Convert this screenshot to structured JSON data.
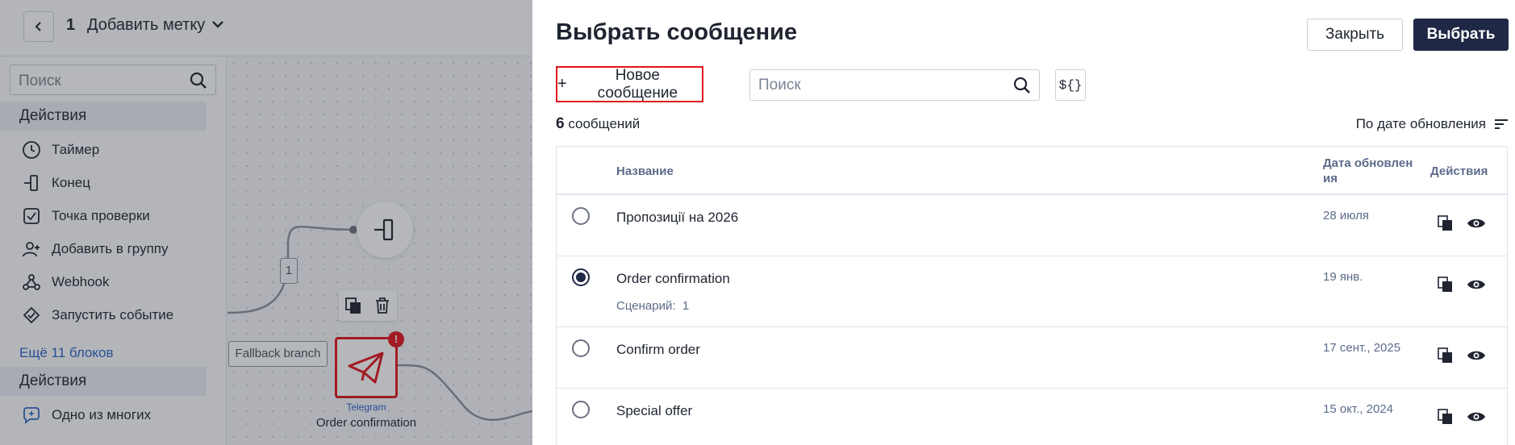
{
  "topbar": {
    "step_number": "1",
    "add_label": "Добавить метку"
  },
  "sidebar": {
    "search_placeholder": "Поиск",
    "section1": "Действия",
    "items": [
      {
        "label": "Таймер",
        "icon": "timer-icon"
      },
      {
        "label": "Конец",
        "icon": "end-icon"
      },
      {
        "label": "Точка проверки",
        "icon": "checkpoint-icon"
      },
      {
        "label": "Добавить в группу",
        "icon": "add-group-icon"
      },
      {
        "label": "Webhook",
        "icon": "webhook-icon"
      },
      {
        "label": "Запустить событие",
        "icon": "event-icon"
      }
    ],
    "more": "Ещё 11 блоков",
    "section2": "Действия",
    "items2": [
      {
        "label": "Одно из многих",
        "icon": "sparkle-icon"
      }
    ]
  },
  "canvas": {
    "edge_label": "1",
    "fallback": "Fallback branch",
    "node_type": "Telegram",
    "node_name": "Order confirmation",
    "badge": "!"
  },
  "drawer": {
    "title": "Выбрать сообщение",
    "close_label": "Закрыть",
    "select_label": "Выбрать",
    "new_message_label": "Новое сообщение",
    "search_placeholder": "Поиск",
    "var_label": "${}",
    "count_number": "6",
    "count_label": "сообщений",
    "sort_label": "По дате обновления",
    "columns": {
      "name": "Название",
      "date_line1": "Дата обновлен",
      "date_line2": "ия",
      "actions": "Действия"
    },
    "rows": [
      {
        "name": "Пропозиції на 2026",
        "date": "28 июля",
        "selected": false,
        "scenarios": ""
      },
      {
        "name": "Order confirmation",
        "date": "19 янв.",
        "selected": true,
        "scenarios_label": "Сценарий:",
        "scenarios": "1"
      },
      {
        "name": "Confirm order",
        "date": "17 сент., 2025",
        "selected": false,
        "scenarios": ""
      },
      {
        "name": "Special offer",
        "date": "15 окт., 2024",
        "selected": false,
        "scenarios": ""
      }
    ]
  }
}
